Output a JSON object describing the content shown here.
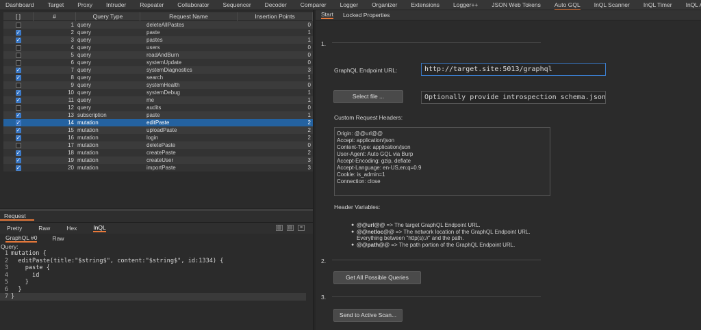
{
  "topnav": {
    "tabs": [
      "Dashboard",
      "Target",
      "Proxy",
      "Intruder",
      "Repeater",
      "Collaborator",
      "Sequencer",
      "Decoder",
      "Comparer",
      "Logger",
      "Organizer",
      "Extensions",
      "Logger++",
      "JSON Web Tokens",
      "Auto GQL",
      "InQL Scanner",
      "InQL Timer",
      "InQL A"
    ],
    "active": "Auto GQL"
  },
  "table": {
    "headers": [
      "[ ]",
      "#",
      "Query Type",
      "Request Name",
      "Insertion Points"
    ],
    "rows": [
      {
        "checked": false,
        "num": "1",
        "type": "query",
        "name": "deleteAllPastes",
        "points": "0"
      },
      {
        "checked": true,
        "num": "2",
        "type": "query",
        "name": "paste",
        "points": "1"
      },
      {
        "checked": true,
        "num": "3",
        "type": "query",
        "name": "pastes",
        "points": "1"
      },
      {
        "checked": false,
        "num": "4",
        "type": "query",
        "name": "users",
        "points": "0"
      },
      {
        "checked": false,
        "num": "5",
        "type": "query",
        "name": "readAndBurn",
        "points": "0"
      },
      {
        "checked": false,
        "num": "6",
        "type": "query",
        "name": "systemUpdate",
        "points": "0"
      },
      {
        "checked": true,
        "num": "7",
        "type": "query",
        "name": "systemDiagnostics",
        "points": "3"
      },
      {
        "checked": true,
        "num": "8",
        "type": "query",
        "name": "search",
        "points": "1"
      },
      {
        "checked": false,
        "num": "9",
        "type": "query",
        "name": "systemHealth",
        "points": "0"
      },
      {
        "checked": true,
        "num": "10",
        "type": "query",
        "name": "systemDebug",
        "points": "1"
      },
      {
        "checked": true,
        "num": "11",
        "type": "query",
        "name": "me",
        "points": "1"
      },
      {
        "checked": false,
        "num": "12",
        "type": "query",
        "name": "audits",
        "points": "0"
      },
      {
        "checked": true,
        "num": "13",
        "type": "subscription",
        "name": "paste",
        "points": "1"
      },
      {
        "checked": true,
        "num": "14",
        "type": "mutation",
        "name": "editPaste",
        "points": "2"
      },
      {
        "checked": true,
        "num": "15",
        "type": "mutation",
        "name": "uploadPaste",
        "points": "2"
      },
      {
        "checked": true,
        "num": "16",
        "type": "mutation",
        "name": "login",
        "points": "2"
      },
      {
        "checked": false,
        "num": "17",
        "type": "mutation",
        "name": "deletePaste",
        "points": "0"
      },
      {
        "checked": true,
        "num": "18",
        "type": "mutation",
        "name": "createPaste",
        "points": "2"
      },
      {
        "checked": true,
        "num": "19",
        "type": "mutation",
        "name": "createUser",
        "points": "3"
      },
      {
        "checked": true,
        "num": "20",
        "type": "mutation",
        "name": "importPaste",
        "points": "3"
      }
    ],
    "selected_row": "14"
  },
  "request": {
    "tab": "Request",
    "format_tabs": [
      "Pretty",
      "Raw",
      "Hex",
      "InQL"
    ],
    "active_format": "InQL",
    "sub_tabs": [
      "GraphQL #0",
      "Raw"
    ],
    "query_label": "Query:",
    "code": [
      "mutation {",
      "  editPaste(title:\"$string$\", content:\"$string$\", id:1334) {",
      "    paste {",
      "      id",
      "    }",
      "  }",
      "}"
    ],
    "line_numbers": [
      "1",
      "2",
      "3",
      "4",
      "5",
      "6",
      "7"
    ]
  },
  "right": {
    "tabs": [
      "Start",
      "Locked Properties"
    ],
    "active_tab": "Start",
    "step1": "1.",
    "endpoint_label": "GraphQL Endpoint URL:",
    "endpoint_value": "http://target.site:5013/graphql",
    "select_file_label": "Select file ...",
    "schema_placeholder": "Optionally provide introspection schema.json. UR",
    "headers_label": "Custom Request Headers:",
    "headers": [
      "Origin: @@url@@",
      "Accept: application/json",
      "Content-Type: application/json",
      "User-Agent: Auto GQL via Burp",
      "Accept-Encoding: gzip, deflate",
      "Accept-Language: en-US,en;q=0.9",
      "Cookie: is_admin=1",
      "Connection: close"
    ],
    "vars_label": "Header Variables:",
    "vars": [
      {
        "key": "@@url@@",
        "desc": " => The target GraphQL Endpoint URL."
      },
      {
        "key": "@@netloc@@",
        "desc": " => The network location of the GraphQL Endpoint URL."
      },
      {
        "key": "@@path@@",
        "desc": " => The path portion of the GraphQL Endpoint URL."
      }
    ],
    "vars_cont": "Everything between \"http(s)://\" and the path.",
    "step2": "2.",
    "get_queries_label": "Get All Possible Queries",
    "step3": "3.",
    "active_scan_label": "Send to Active Scan..."
  }
}
